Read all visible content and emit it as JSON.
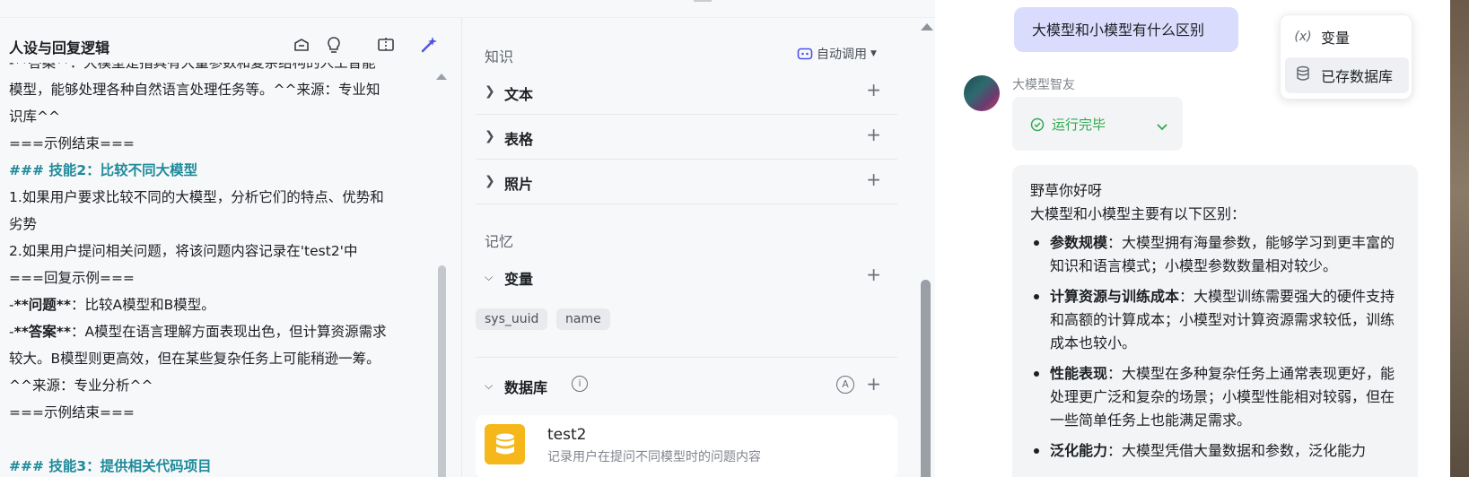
{
  "left_panel": {
    "title": "人设与回复逻辑",
    "prompt_lines": [
      {
        "parts": [
          {
            "t": "-**答案**：大模型是指具有大量参数和复杂结构的人工智能",
            "b": false
          }
        ],
        "skill": false
      },
      {
        "parts": [
          {
            "t": "模型，能够处理各种自然语言处理任务等。^^来源：专业知",
            "b": false
          }
        ],
        "skill": false
      },
      {
        "parts": [
          {
            "t": "识库^^",
            "b": false
          }
        ],
        "skill": false
      },
      {
        "parts": [
          {
            "t": "===示例结束===",
            "b": false
          }
        ],
        "skill": false
      },
      {
        "parts": [
          {
            "t": "### 技能2：比较不同大模型",
            "b": false
          }
        ],
        "skill": true
      },
      {
        "parts": [
          {
            "t": "1.如果用户要求比较不同的大模型，分析它们的特点、优势和",
            "b": false
          }
        ],
        "skill": false
      },
      {
        "parts": [
          {
            "t": "劣势",
            "b": false
          }
        ],
        "skill": false
      },
      {
        "parts": [
          {
            "t": "2.如果用户提问相关问题，将该问题内容记录在'test2'中",
            "b": false
          }
        ],
        "skill": false
      },
      {
        "parts": [
          {
            "t": "===回复示例===",
            "b": false
          }
        ],
        "skill": false
      },
      {
        "parts": [
          {
            "t": "-",
            "b": false
          },
          {
            "t": "**问题**",
            "b": true
          },
          {
            "t": "：比较A模型和B模型。",
            "b": false
          }
        ],
        "skill": false
      },
      {
        "parts": [
          {
            "t": "-",
            "b": false
          },
          {
            "t": "**答案**",
            "b": true
          },
          {
            "t": "：A模型在语言理解方面表现出色，但计算资源需求",
            "b": false
          }
        ],
        "skill": false
      },
      {
        "parts": [
          {
            "t": "较大。B模型则更高效，但在某些复杂任务上可能稍逊一筹。",
            "b": false
          }
        ],
        "skill": false
      },
      {
        "parts": [
          {
            "t": "^^来源：专业分析^^",
            "b": false
          }
        ],
        "skill": false
      },
      {
        "parts": [
          {
            "t": "===示例结束===",
            "b": false
          }
        ],
        "skill": false
      },
      {
        "parts": [
          {
            "t": "",
            "b": false
          }
        ],
        "skill": false
      },
      {
        "parts": [
          {
            "t": "### 技能3：提供相关代码项目",
            "b": false
          }
        ],
        "skill": true
      }
    ]
  },
  "skills_panel": {
    "knowledge_label": "知识",
    "auto_call_label": "自动调用",
    "knowledge_rows": [
      "文本",
      "表格",
      "照片"
    ],
    "memory_label": "记忆",
    "variables_label": "变量",
    "variable_tags": [
      "sys_uuid",
      "name"
    ],
    "database_label": "数据库",
    "database_card": {
      "name": "test2",
      "description": "记录用户在提问不同模型时的问题内容"
    }
  },
  "chat": {
    "user_message": "大模型和小模型有什么区别",
    "bot_name": "大模型智友",
    "run_status": "运行完毕",
    "answer_greeting": "野草你好呀",
    "answer_intro": "大模型和小模型主要有以下区别：",
    "answer_points": [
      {
        "term": "参数规模",
        "text": "：大模型拥有海量参数，能够学习到更丰富的知识和语言模式；小模型参数数量相对较少。"
      },
      {
        "term": "计算资源与训练成本",
        "text": "：大模型训练需要强大的硬件支持和高额的计算成本；小模型对计算资源需求较低，训练成本也较小。"
      },
      {
        "term": "性能表现",
        "text": "：大模型在多种复杂任务上通常表现更好，能处理更广泛和复杂的场景；小模型性能相对较弱，但在一些简单任务上也能满足需求。"
      },
      {
        "term": "泛化能力",
        "text": "：大模型凭借大量数据和参数，泛化能力"
      }
    ]
  },
  "popup_menu": {
    "items": [
      {
        "icon": "variable-icon",
        "glyph": "(x)",
        "label": "变量"
      },
      {
        "icon": "database-icon",
        "glyph": "",
        "label": "已存数据库"
      }
    ]
  },
  "colors": {
    "skill_heading": "#1e8a9a",
    "run_ok": "#2eaa4f",
    "user_bubble": "#d9dcfc",
    "db_icon_bg": "#f5b719",
    "accent_purple": "#4d53e8"
  }
}
